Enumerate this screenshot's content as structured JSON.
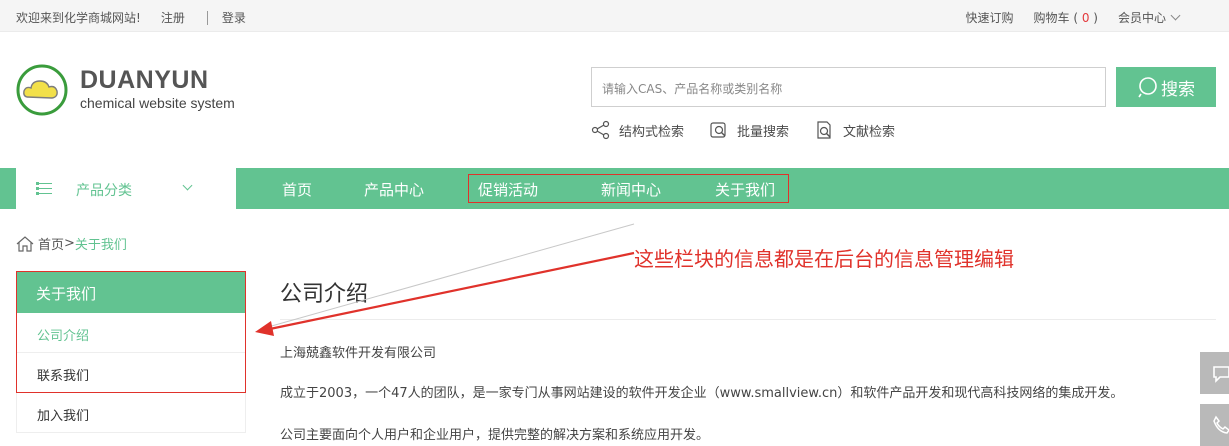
{
  "topbar": {
    "welcome": "欢迎来到化学商城网站!",
    "register": "注册",
    "login": "登录",
    "quick_order": "快速订购",
    "cart_label": "购物车",
    "cart_open": "(",
    "cart_count": "0",
    "cart_close": ")",
    "member_center": "会员中心"
  },
  "brand": {
    "name": "DUANYUN",
    "subtitle": "chemical website system"
  },
  "search": {
    "placeholder": "请输入CAS、产品名称或类别名称",
    "button": "搜索",
    "quick_links": [
      "结构式检索",
      "批量搜索",
      "文献检索"
    ]
  },
  "nav": {
    "category_label": "产品分类",
    "items": [
      "首页",
      "产品中心",
      "促销活动",
      "新闻中心",
      "关于我们"
    ]
  },
  "breadcrumb": {
    "home": "首页",
    "separator": ">",
    "current": "关于我们"
  },
  "sidebar": {
    "title": "关于我们",
    "items": [
      "公司介绍",
      "联系我们",
      "加入我们"
    ]
  },
  "content": {
    "title": "公司介绍",
    "paragraphs": [
      "上海兢鑫软件开发有限公司",
      "成立于2003，一个47人的团队，是一家专门从事网站建设的软件开发企业（www.smallview.cn）和软件产品开发和现代高科技网络的集成开发。",
      "公司主要面向个人用户和企业用户，提供完整的解决方案和系统应用开发。"
    ]
  },
  "annotation": "这些栏块的信息都是在后台的信息管理编辑",
  "colors": {
    "accent": "#62c391",
    "annotation_red": "#e0322b",
    "cart_count": "#e4393c"
  }
}
